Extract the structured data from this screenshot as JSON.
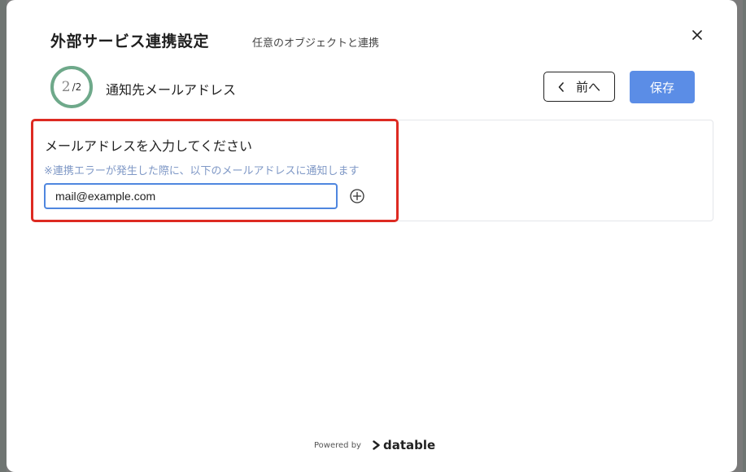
{
  "modal": {
    "title": "外部サービス連携設定",
    "subtitle": "任意のオブジェクトと連携",
    "close_icon": "close-icon"
  },
  "step": {
    "current": "2",
    "total": "/2",
    "progress_fraction": 1.0,
    "label": "通知先メールアドレス"
  },
  "actions": {
    "prev_label": "前へ",
    "prev_icon": "chevron-left-icon",
    "save_label": "保存"
  },
  "form": {
    "label": "メールアドレスを入力してください",
    "hint": "※連携エラーが発生した際に、以下のメールアドレスに通知します",
    "email_value": "mail@example.com",
    "add_icon": "plus-circle-icon"
  },
  "footer": {
    "powered_by": "Powered by",
    "brand": "datable"
  },
  "colors": {
    "accent": "#5b8de6",
    "progress": "#6ea98a",
    "highlight": "#dd2a22",
    "hint": "#7f98c6"
  }
}
